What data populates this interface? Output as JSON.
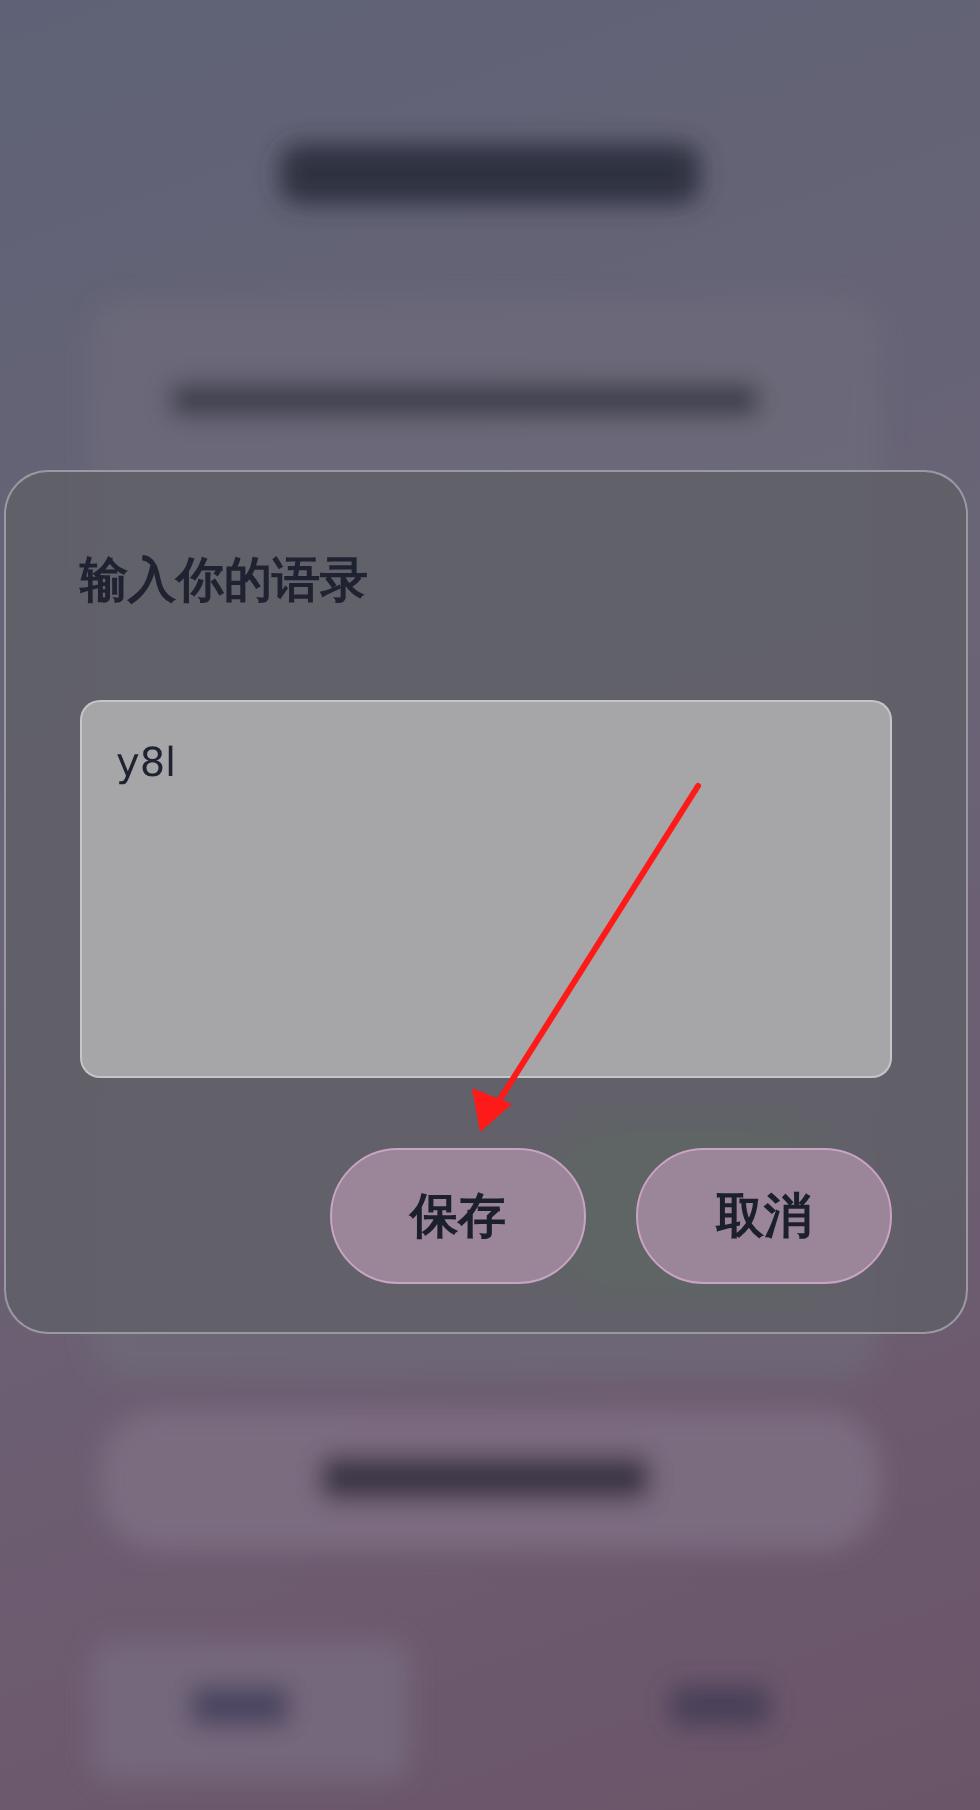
{
  "dialog": {
    "title": "输入你的语录",
    "field": {
      "value": "y8l"
    },
    "buttons": [
      {
        "label": "保存"
      },
      {
        "label": "取消"
      }
    ]
  }
}
